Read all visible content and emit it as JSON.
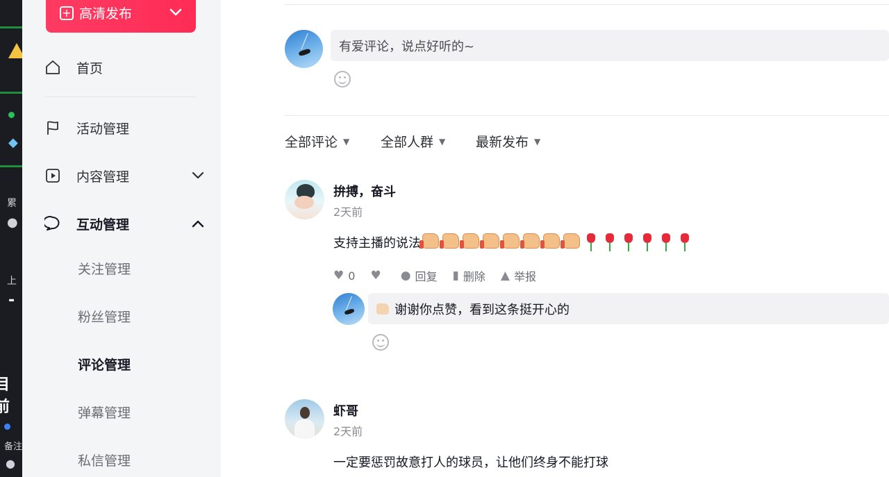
{
  "background_app": {
    "fragments": [
      "累",
      "上",
      "-",
      "目前",
      "备注"
    ]
  },
  "sidebar": {
    "publish_label": "高清发布",
    "nav": [
      {
        "label": "首页",
        "icon": "home-icon"
      },
      {
        "label": "活动管理",
        "icon": "flag-icon"
      },
      {
        "label": "内容管理",
        "icon": "play-icon"
      },
      {
        "label": "互动管理",
        "icon": "chat-icon"
      }
    ],
    "sub_items": [
      {
        "label": "关注管理",
        "active": false
      },
      {
        "label": "粉丝管理",
        "active": false
      },
      {
        "label": "评论管理",
        "active": true
      },
      {
        "label": "弹幕管理",
        "active": false
      },
      {
        "label": "私信管理",
        "active": false
      }
    ]
  },
  "composer": {
    "placeholder": "有爱评论，说点好听的~"
  },
  "filters": [
    "全部评论",
    "全部人群",
    "最新发布"
  ],
  "comments": [
    {
      "author": "拚搏，奋斗",
      "time": "2天前",
      "text": "支持主播的说法",
      "likes": "0",
      "reply_label": "回复",
      "delete_label": "删除",
      "report_label": "举报",
      "reply_text": "谢谢你点赞，看到这条挺开心的"
    },
    {
      "author": "虾哥",
      "time": "2天前",
      "text": "一定要惩罚故意打人的球员，让他们终身不能打球"
    }
  ],
  "colors": {
    "brand": "#fe2c55",
    "sidebar_bg": "#f4f5f7",
    "input_bg": "#f2f2f4"
  }
}
